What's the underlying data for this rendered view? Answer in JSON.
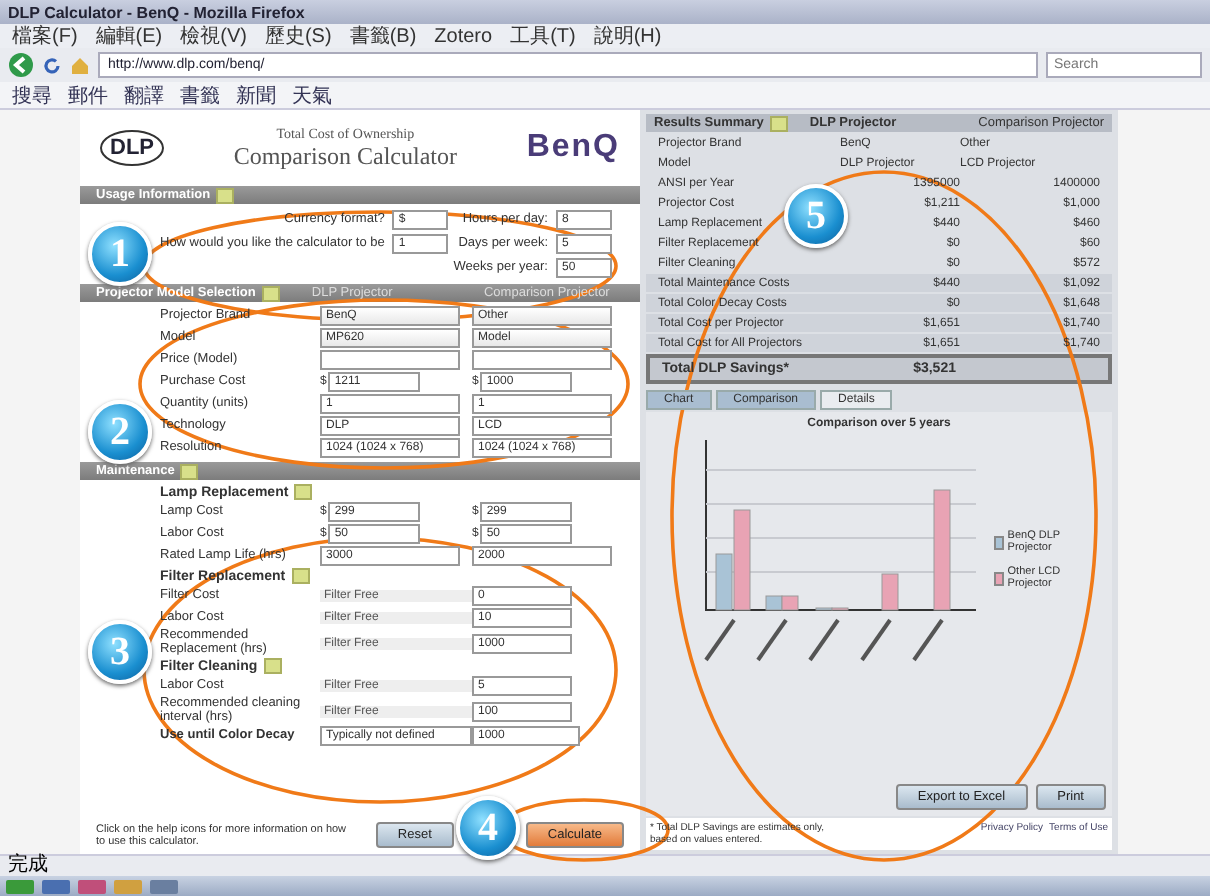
{
  "window": {
    "title": "DLP Calculator - BenQ - Mozilla Firefox"
  },
  "menu": [
    "檔案(F)",
    "編輯(E)",
    "檢視(V)",
    "歷史(S)",
    "書籤(B)",
    "Zotero",
    "工具(T)",
    "說明(H)"
  ],
  "address": "http://www.dlp.com/benq/",
  "search": {
    "placeholder": "Search"
  },
  "toolbar": [
    "搜尋",
    "郵件",
    "翻譯",
    "書籤",
    "新聞",
    "天氣"
  ],
  "header": {
    "logo": "DLP",
    "title_top": "Total Cost of Ownership",
    "title": "Comparison Calculator",
    "brand": "BenQ"
  },
  "usage": {
    "title": "Usage Information",
    "left": [
      {
        "label": "Currency format?",
        "value": "$"
      },
      {
        "label": "How would you like the calculator to be",
        "value": "1"
      }
    ],
    "right": [
      {
        "label": "Hours per day:",
        "value": "8"
      },
      {
        "label": "Days per week:",
        "value": "5"
      },
      {
        "label": "Weeks per year:",
        "value": "50"
      }
    ]
  },
  "selection": {
    "title": "Projector Model Selection",
    "col_a": "DLP Projector",
    "col_b": "Comparison Projector",
    "rows": [
      {
        "label": "Projector Brand",
        "a": "BenQ",
        "b": "Other",
        "kind": "select"
      },
      {
        "label": "Model",
        "a": "MP620",
        "b": "Model",
        "kind": "select"
      },
      {
        "label": "Price (Model)",
        "a": "",
        "b": "",
        "kind": "input"
      },
      {
        "label": "Purchase Cost",
        "a": "1211",
        "b": "1000",
        "kind": "money",
        "currency": "$"
      },
      {
        "label": "Quantity (units)",
        "a": "1",
        "b": "1",
        "kind": "input"
      },
      {
        "label": "Technology",
        "a": "DLP",
        "b": "LCD",
        "kind": "input"
      },
      {
        "label": "Resolution",
        "a": "1024 (1024 x 768)",
        "b": "1024 (1024 x 768)",
        "kind": "input"
      }
    ]
  },
  "maintenance": {
    "title": "Maintenance",
    "rows": [
      {
        "kind": "heading",
        "label": "Lamp Replacement"
      },
      {
        "kind": "money",
        "label": "Lamp Cost",
        "a": "299",
        "b": "299",
        "currency": "$"
      },
      {
        "kind": "money",
        "label": "Labor Cost",
        "a": "50",
        "b": "50",
        "currency": "$"
      },
      {
        "kind": "input",
        "label": "Rated Lamp Life (hrs)",
        "a": "3000",
        "b": "2000"
      },
      {
        "kind": "heading",
        "label": "Filter Replacement"
      },
      {
        "kind": "free",
        "label": "Filter Cost",
        "a": "Filter Free",
        "b": "0"
      },
      {
        "kind": "free",
        "label": "Labor Cost",
        "a": "Filter Free",
        "b": "10"
      },
      {
        "kind": "free",
        "label": "Recommended Replacement (hrs)",
        "a": "Filter Free",
        "b": "1000"
      },
      {
        "kind": "heading",
        "label": "Filter Cleaning"
      },
      {
        "kind": "free",
        "label": "Labor Cost",
        "a": "Filter Free",
        "b": "5"
      },
      {
        "kind": "free",
        "label": "Recommended cleaning interval (hrs)",
        "a": "Filter Free",
        "b": "100"
      },
      {
        "kind": "decay",
        "label": "Use until Color Decay",
        "a": "Typically not defined",
        "b": "1000"
      }
    ]
  },
  "help_note": "Click on the help icons for more information on how to use this calculator.",
  "buttons": {
    "reset": "Reset",
    "calculate": "Calculate"
  },
  "results": {
    "title": "Results Summary",
    "col_a": "DLP Projector",
    "col_b": "Comparison Projector",
    "info": [
      {
        "label": "Projector Brand",
        "a": "BenQ",
        "b": "Other"
      },
      {
        "label": "Model",
        "a": "DLP Projector",
        "b": "LCD Projector"
      }
    ],
    "rows": [
      {
        "label": "ANSI per Year",
        "a": "1395000",
        "b": "1400000"
      },
      {
        "label": "Projector Cost",
        "a": "$1,211",
        "b": "$1,000"
      },
      {
        "label": "Lamp Replacement",
        "a": "$440",
        "b": "$460"
      },
      {
        "label": "Filter Replacement",
        "a": "$0",
        "b": "$60"
      },
      {
        "label": "Filter Cleaning",
        "a": "$0",
        "b": "$572"
      }
    ],
    "totals": [
      {
        "label": "Total Maintenance Costs",
        "a": "$440",
        "b": "$1,092"
      },
      {
        "label": "Total Color Decay Costs",
        "a": "$0",
        "b": "$1,648"
      },
      {
        "label": "Total Cost per Projector",
        "a": "$1,651",
        "b": "$1,740"
      },
      {
        "label": "Total Cost for All Projectors",
        "a": "$1,651",
        "b": "$1,740"
      }
    ],
    "savings": {
      "label": "Total DLP Savings*",
      "value": "$3,521"
    },
    "tabs": [
      {
        "label": "Chart",
        "selected": false
      },
      {
        "label": "Comparison",
        "selected": false
      },
      {
        "label": "Details",
        "selected": true
      }
    ],
    "chart_title": "Comparison over 5 years",
    "legend": [
      {
        "label": "BenQ DLP Projector",
        "color": "#a9c3d6"
      },
      {
        "label": "Other LCD Projector",
        "color": "#e8a3b4"
      }
    ],
    "actions": [
      "Export to Excel",
      "Print"
    ],
    "note": "* Total DLP Savings are estimates only, based on values entered.",
    "links": [
      "Privacy Policy",
      "Terms of Use"
    ]
  },
  "status": "完成",
  "annotations": [
    "1",
    "2",
    "3",
    "4",
    "5"
  ]
}
